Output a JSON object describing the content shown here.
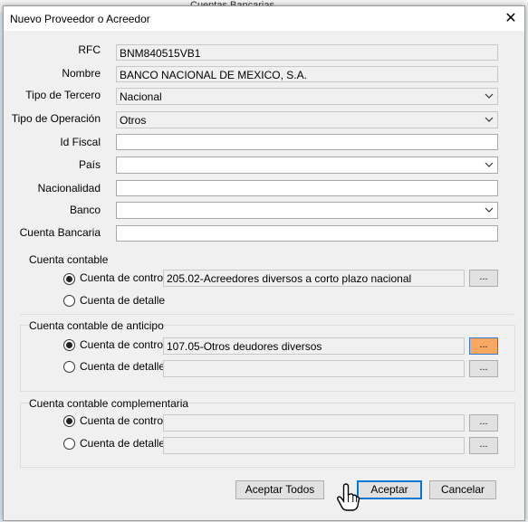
{
  "background": {
    "tab_label": "Cuentas Bancarias"
  },
  "dialog": {
    "title": "Nuevo Proveedor o Acreedor",
    "close": "✕"
  },
  "form": {
    "rfc_label": "RFC",
    "rfc_value": "BNM840515VB1",
    "nombre_label": "Nombre",
    "nombre_value": "BANCO NACIONAL DE MEXICO, S.A.",
    "tipo_tercero_label": "Tipo de Tercero",
    "tipo_tercero_value": "Nacional",
    "tipo_operacion_label": "Tipo de Operación",
    "tipo_operacion_value": "Otros",
    "id_fiscal_label": "Id Fiscal",
    "id_fiscal_value": "",
    "pais_label": "País",
    "pais_value": "",
    "nacionalidad_label": "Nacionalidad",
    "nacionalidad_value": "",
    "banco_label": "Banco",
    "banco_value": "",
    "cuenta_bancaria_label": "Cuenta Bancaria",
    "cuenta_bancaria_value": ""
  },
  "cuenta_contable": {
    "title": "Cuenta contable",
    "control_label": "Cuenta de control",
    "control_value": "205.02-Acreedores diversos a corto plazo nacional",
    "detalle_label": "Cuenta de detalle",
    "detalle_value": "",
    "selected": "control",
    "browse_label": "..."
  },
  "cuenta_anticipo": {
    "title": "Cuenta contable de anticipo",
    "control_label": "Cuenta de control",
    "control_value": "107.05-Otros deudores diversos",
    "detalle_label": "Cuenta de detalle",
    "detalle_value": "",
    "selected": "control",
    "browse_label": "..."
  },
  "cuenta_complementaria": {
    "title": "Cuenta contable complementaria",
    "control_label": "Cuenta de control",
    "control_value": "",
    "detalle_label": "Cuenta de detalle",
    "detalle_value": "",
    "selected": "control",
    "browse_label": "..."
  },
  "buttons": {
    "aceptar_todos": "Aceptar Todos",
    "aceptar": "Aceptar",
    "cancelar": "Cancelar"
  },
  "colors": {
    "highlight_browse": "#f8a860",
    "focus_border": "#0078d7"
  }
}
